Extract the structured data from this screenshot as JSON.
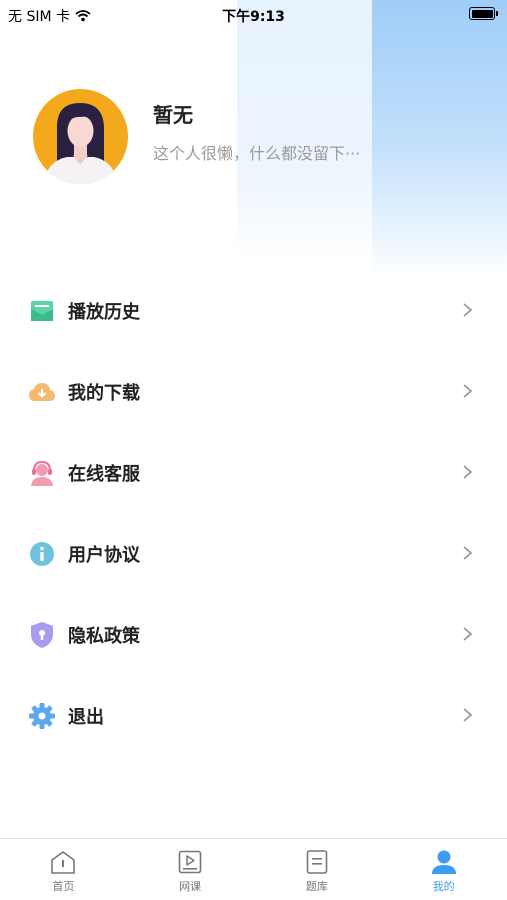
{
  "status_bar": {
    "carrier": "无 SIM 卡",
    "time": "下午9:13"
  },
  "profile": {
    "name": "暂无",
    "bio": "这个人很懒，什么都没留下···"
  },
  "menu": {
    "items": [
      {
        "label": "播放历史",
        "icon": "play-history-icon",
        "color": "#5ed3a8"
      },
      {
        "label": "我的下载",
        "icon": "cloud-download-icon",
        "color": "#f5b971"
      },
      {
        "label": "在线客服",
        "icon": "customer-service-icon",
        "color": "#f39bb0"
      },
      {
        "label": "用户协议",
        "icon": "info-icon",
        "color": "#6fc3dd"
      },
      {
        "label": "隐私政策",
        "icon": "shield-lock-icon",
        "color": "#a99bf0"
      },
      {
        "label": "退出",
        "icon": "gear-icon",
        "color": "#5ea8ee"
      }
    ]
  },
  "tab_bar": {
    "active_color": "#3d9cf2",
    "tabs": [
      {
        "label": "首页",
        "icon": "home-icon"
      },
      {
        "label": "网课",
        "icon": "video-course-icon"
      },
      {
        "label": "题库",
        "icon": "question-bank-icon"
      },
      {
        "label": "我的",
        "icon": "profile-icon",
        "active": true
      }
    ]
  }
}
